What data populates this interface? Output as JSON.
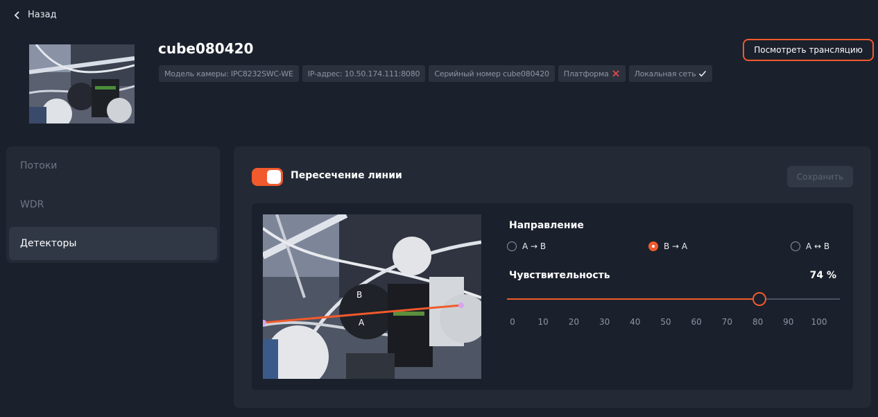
{
  "nav": {
    "back_label": "Назад"
  },
  "camera": {
    "name": "cube080420",
    "tags": [
      {
        "text": "Модель камеры: IPC8232SWC-WE",
        "status": ""
      },
      {
        "text": "IP-адрес: 10.50.174.111:8080",
        "status": ""
      },
      {
        "text": "Серийный номер cube080420",
        "status": ""
      },
      {
        "text": "Платформа",
        "status": "cross"
      },
      {
        "text": "Локальная сеть",
        "status": "check"
      }
    ],
    "watch_button": "Посмотреть трансляцию"
  },
  "sidebar": {
    "items": [
      {
        "label": "Потоки",
        "active": false
      },
      {
        "label": "WDR",
        "active": false
      },
      {
        "label": "Детекторы",
        "active": true
      }
    ]
  },
  "detector": {
    "toggle_label": "Пересечение линии",
    "enabled": true,
    "save_label": "Сохранить",
    "preview": {
      "label_a": "A",
      "label_b": "B"
    },
    "direction_title": "Направление",
    "directions": [
      {
        "label": "A → B",
        "selected": false
      },
      {
        "label": "B → A",
        "selected": true
      },
      {
        "label": "A ↔ B",
        "selected": false
      }
    ],
    "sensitivity_title": "Чувствительность",
    "sensitivity_value": "74 %",
    "sensitivity_fraction": 0.74,
    "ticks": [
      "0",
      "10",
      "20",
      "30",
      "40",
      "50",
      "60",
      "70",
      "80",
      "90",
      "100"
    ]
  },
  "colors": {
    "accent": "#f15a2c",
    "background": "#1b212c",
    "panel": "#232a35"
  }
}
